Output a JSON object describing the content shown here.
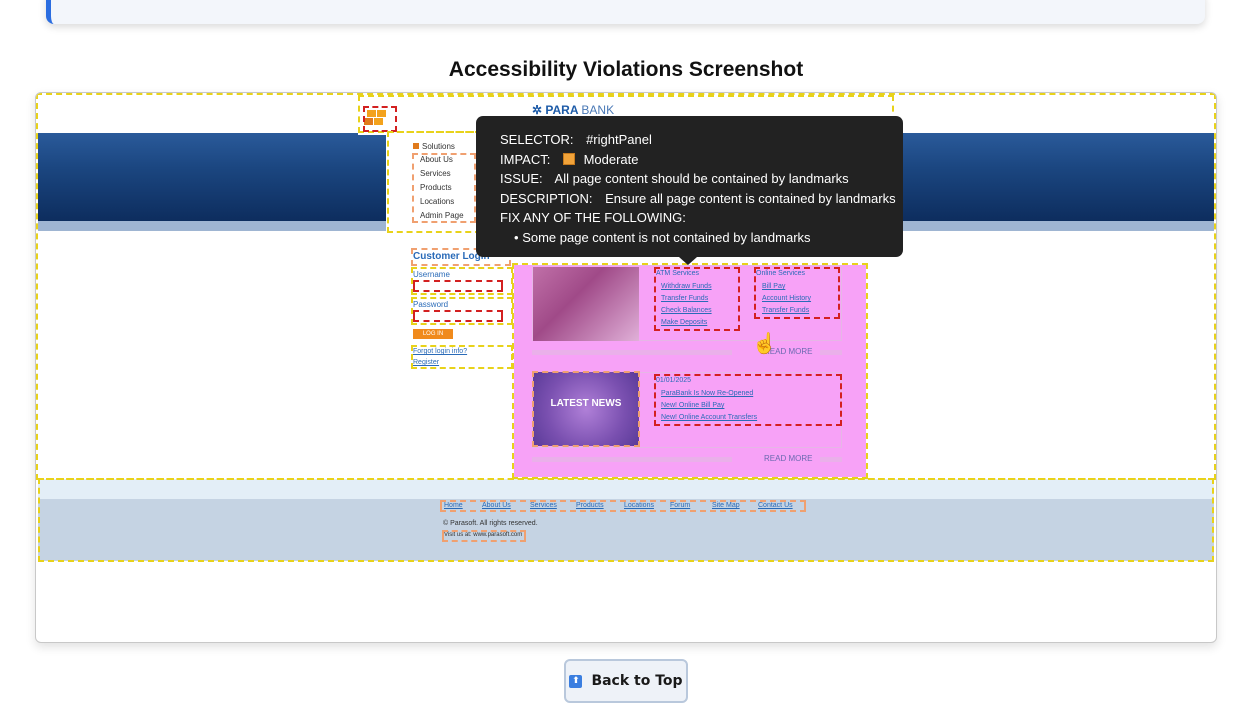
{
  "section_title": "Accessibility Violations Screenshot",
  "screenshot": {
    "logo": {
      "brand": "PARA",
      "suffix": "BANK"
    },
    "nav": {
      "heading": "Solutions",
      "items": [
        "About Us",
        "Services",
        "Products",
        "Locations",
        "Admin Page"
      ]
    },
    "login": {
      "title": "Customer Login",
      "username_label": "Username",
      "password_label": "Password",
      "button": "LOG IN",
      "forgot": "Forgot login info?",
      "register": "Register"
    },
    "panel": {
      "atm_heading": "ATM Services",
      "atm_links": [
        "Withdraw Funds",
        "Transfer Funds",
        "Check Balances",
        "Make Deposits"
      ],
      "online_heading": "Online Services",
      "online_links": [
        "Bill Pay",
        "Account History",
        "Transfer Funds"
      ],
      "read_more": "READ MORE",
      "news_image_text": "LATEST NEWS",
      "news_date": "01/01/2025",
      "news_links": [
        "ParaBank Is Now Re-Opened",
        "New! Online Bill Pay",
        "New! Online Account Transfers"
      ],
      "read_more_2": "READ MORE"
    },
    "footer": {
      "links": [
        "Home",
        "About Us",
        "Services",
        "Products",
        "Locations",
        "Forum",
        "Site Map",
        "Contact Us"
      ],
      "copyright": "© Parasoft. All rights reserved.",
      "visit": "Visit us at: www.parasoft.com"
    }
  },
  "tooltip": {
    "selector_label": "SELECTOR:",
    "selector_value": "#rightPanel",
    "impact_label": "IMPACT:",
    "impact_value": "Moderate",
    "impact_color": "#f1a33a",
    "issue_label": "ISSUE:",
    "issue_value": "All page content should be contained by landmarks",
    "description_label": "DESCRIPTION:",
    "description_value": "Ensure all page content is contained by landmarks",
    "fix_label": "FIX ANY OF THE FOLLOWING:",
    "fix_items": [
      "Some page content is not contained by landmarks"
    ]
  },
  "back_to_top": {
    "label": "Back to Top",
    "icon": "arrow-up-icon"
  }
}
